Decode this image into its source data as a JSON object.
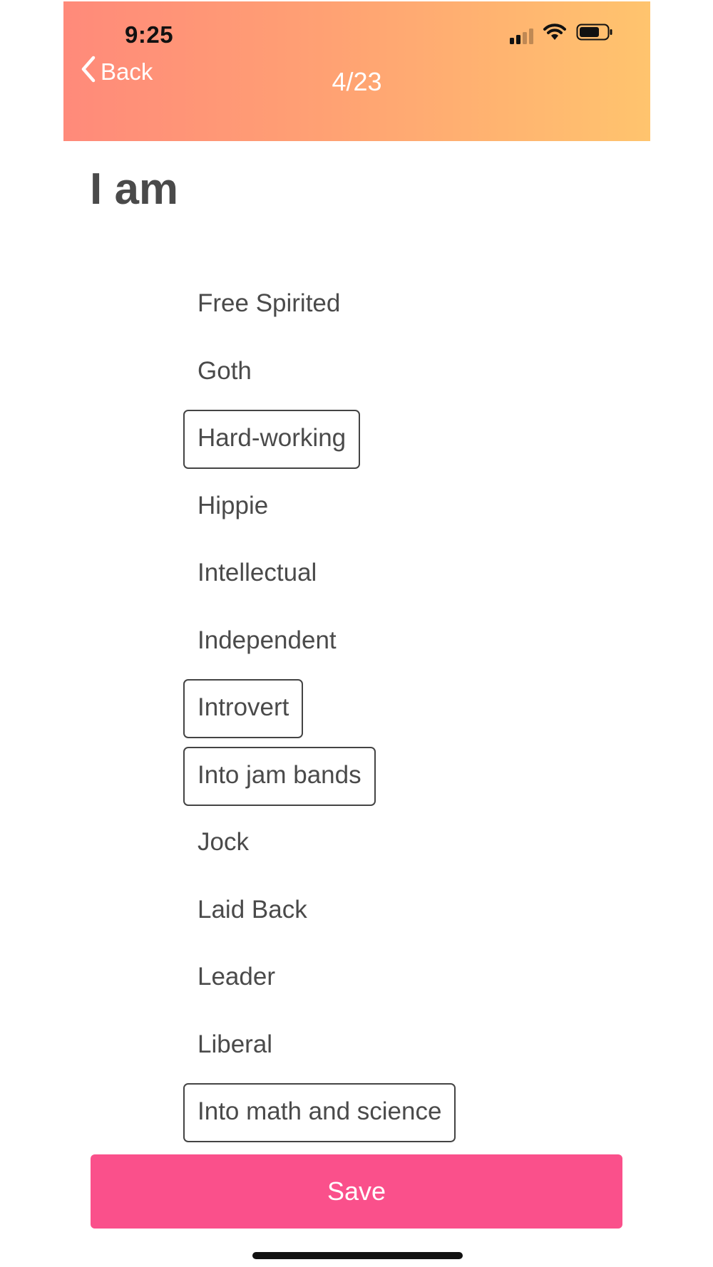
{
  "status_bar": {
    "time": "9:25",
    "icons": [
      "signal-icon",
      "wifi-icon",
      "battery-icon"
    ]
  },
  "header": {
    "back_label": "Back",
    "step": "4/23",
    "gradient_start": "#ff8a7a",
    "gradient_end": "#ffc46e"
  },
  "title": "I am",
  "options": [
    {
      "label": "Free Spirited",
      "selected": false
    },
    {
      "label": "Goth",
      "selected": false
    },
    {
      "label": "Hard-working",
      "selected": true
    },
    {
      "label": "Hippie",
      "selected": false
    },
    {
      "label": "Intellectual",
      "selected": false
    },
    {
      "label": "Independent",
      "selected": false
    },
    {
      "label": "Introvert",
      "selected": true
    },
    {
      "label": "Into jam bands",
      "selected": true
    },
    {
      "label": "Jock",
      "selected": false
    },
    {
      "label": "Laid Back",
      "selected": false
    },
    {
      "label": "Leader",
      "selected": false
    },
    {
      "label": "Liberal",
      "selected": false
    },
    {
      "label": "Into math and science",
      "selected": true
    }
  ],
  "save_label": "Save",
  "colors": {
    "accent": "#fa508b",
    "text": "#4a4a4a",
    "selected_border": "#444444"
  }
}
